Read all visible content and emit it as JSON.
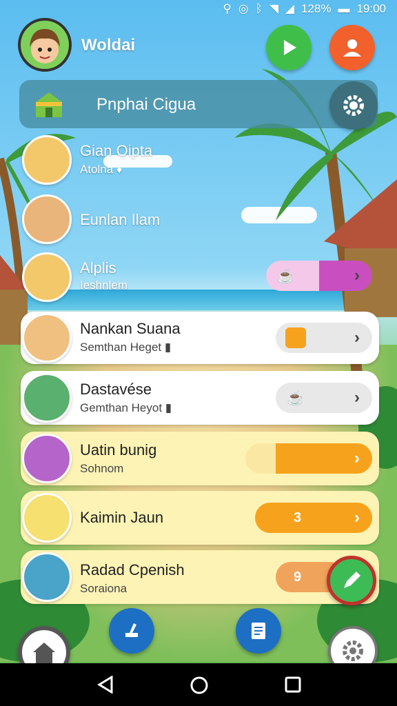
{
  "status_bar": {
    "battery": "128%",
    "time": "19:00"
  },
  "header": {
    "username": "Woldai",
    "banner_title": "Pnphai Cigua"
  },
  "list": [
    {
      "name": "Gian Oipta",
      "sub": "Atolna ♦"
    },
    {
      "name": "Eunlan Ilam",
      "sub": ""
    },
    {
      "name": "Alplis",
      "sub": "Ieshnlem"
    },
    {
      "name": "Nankan Suana",
      "sub": "Semthan Heget ▮"
    },
    {
      "name": "Dastavése",
      "sub": "Gemthan Heyot ▮"
    },
    {
      "name": "Uatin bunig",
      "sub": "Sohnom"
    },
    {
      "name": "Kaimin Jaun",
      "sub": ""
    },
    {
      "name": "Radad Cpenish",
      "sub": "Soraiona"
    }
  ],
  "badges": {
    "row5": "3",
    "row6": "9"
  },
  "colors": {
    "play": "#3fbf4a",
    "profile": "#f2612c",
    "fab": "#3dbb55",
    "orange": "#f7a21c",
    "magenta": "#c94fc0"
  }
}
